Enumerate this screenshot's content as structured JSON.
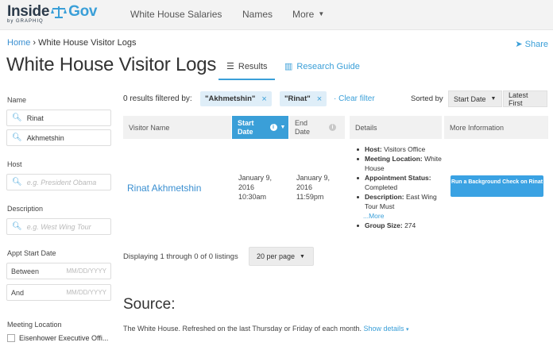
{
  "brand": {
    "name_part1": "Inside",
    "name_part2": "Gov",
    "by": "by GRAPHIQ"
  },
  "nav": {
    "items": [
      "White House Salaries",
      "Names",
      "More"
    ]
  },
  "breadcrumb": {
    "home": "Home",
    "separator": "›",
    "current": "White House Visitor Logs"
  },
  "share_label": "Share",
  "page_title": "White House Visitor Logs",
  "tabs": {
    "results": "Results",
    "guide": "Research Guide"
  },
  "sidebar": {
    "name_label": "Name",
    "name_values": [
      "Rinat",
      "Akhmetshin"
    ],
    "host_label": "Host",
    "host_placeholder": "e.g. President Obama",
    "description_label": "Description",
    "description_placeholder": "e.g. West Wing Tour",
    "appt_label": "Appt Start Date",
    "between_label": "Between",
    "and_label": "And",
    "date_placeholder": "MM/DD/YYYY",
    "meeting_location_label": "Meeting Location",
    "location_option": "Eisenhower Executive Offi..."
  },
  "filters": {
    "summary": "0 results filtered by:",
    "chips": [
      "\"Akhmetshin\"",
      "\"Rinat\""
    ],
    "clear": "Clear filter",
    "sorted_by": "Sorted by",
    "sort_field": "Start Date",
    "sort_order": "Latest First"
  },
  "table": {
    "headers": {
      "visitor_name": "Visitor Name",
      "start_date_1": "Start",
      "start_date_2": "Date",
      "end_date_1": "End",
      "end_date_2": "Date",
      "details": "Details",
      "more_info": "More Information"
    },
    "row": {
      "name": "Rinat Akhmetshin",
      "start": [
        "January 9,",
        "2016",
        "10:30am"
      ],
      "end": [
        "January 9,",
        "2016",
        "11:59pm"
      ],
      "details": {
        "host_label": "Host:",
        "host": "Visitors Office",
        "location_label": "Meeting Location:",
        "location": "White House",
        "status_label": "Appointment Status:",
        "status": "Completed",
        "description_label": "Description:",
        "description": "East Wing Tour Must",
        "more": "...More",
        "group_label": "Group Size:",
        "group": "274"
      },
      "action": "Run a Background Check on Rinat"
    }
  },
  "pagination": {
    "displaying": "Displaying 1 through 0 of 0 listings",
    "per_page": "20 per page"
  },
  "source": {
    "title": "Source:",
    "text": "The White House. Refreshed on the last Thursday or Friday of each month.",
    "link": "Show details"
  },
  "colors": {
    "accent": "#3a9fd8",
    "brand_dark": "#2b3a4a"
  }
}
